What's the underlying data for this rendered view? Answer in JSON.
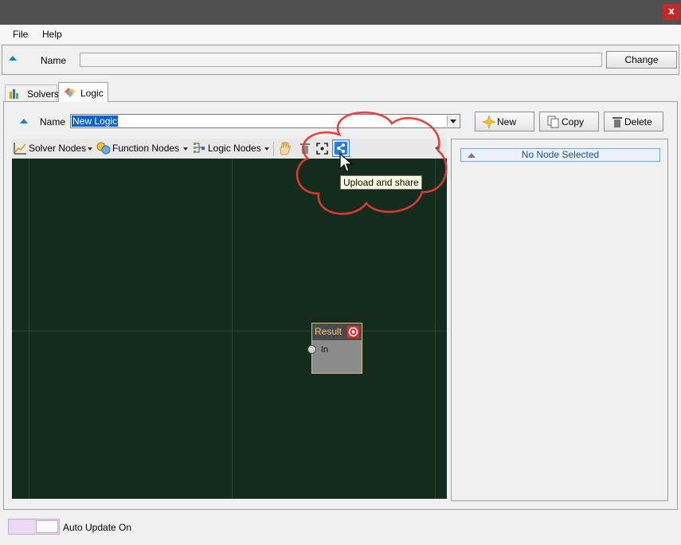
{
  "window": {
    "close_label": "x"
  },
  "menu": {
    "items": [
      {
        "label": "File"
      },
      {
        "label": "Help"
      }
    ]
  },
  "top_name": {
    "label": "Name",
    "value": "",
    "change_button": "Change"
  },
  "tabs": [
    {
      "label": "Solvers"
    },
    {
      "label": "Logic",
      "active": true
    }
  ],
  "logic": {
    "name_label": "Name",
    "name_value": "New Logic",
    "buttons": {
      "new": "New",
      "copy": "Copy",
      "delete": "Delete"
    }
  },
  "toolbar": {
    "solver_nodes": "Solver Nodes",
    "function_nodes": "Function Nodes",
    "logic_nodes": "Logic Nodes",
    "icons": [
      "hand-icon",
      "trash-icon",
      "fit-view-icon",
      "share-icon"
    ]
  },
  "tooltip": "Upload and share",
  "node": {
    "title": "Result",
    "input_port": "In"
  },
  "right_panel": {
    "header": "No Node Selected"
  },
  "footer": {
    "auto_update_label": "Auto Update On"
  },
  "colors": {
    "titlebar": "#505050",
    "close": "#c62828",
    "canvas": "#142c1e",
    "accent": "#1a7fc4",
    "callout": "#e53935",
    "node_title": "#f0c878"
  }
}
